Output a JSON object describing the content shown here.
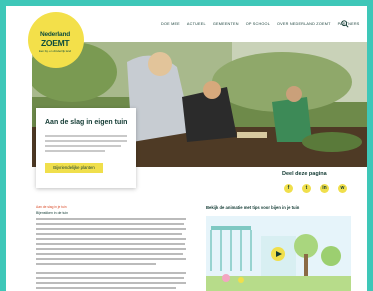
{
  "logo": {
    "line1": "Nederland",
    "line2": "ZOEMT",
    "tagline": "Een bij- en vlinderrijk land"
  },
  "nav": {
    "items": [
      "DOE MEE",
      "ACTUEEL",
      "GEMEENTEN",
      "OP SCHOOL",
      "OVER NEDERLAND ZOEMT",
      "PARTNERS"
    ]
  },
  "hero_card": {
    "title": "Aan de slag in eigen tuin",
    "button_label": "Bijvriendelijke planten"
  },
  "share": {
    "title": "Deel deze pagina",
    "icons": [
      "facebook-icon",
      "twitter-icon",
      "linkedin-icon",
      "whatsapp-icon"
    ]
  },
  "article": {
    "tag": "Aan de slag in je tuin",
    "subtitle": "Bijenstiken in de tuin"
  },
  "video": {
    "title": "Bekijk de animatie met tips voor bijen in je tuin"
  },
  "colors": {
    "teal": "#3ec7b8",
    "yellow": "#f0df4c",
    "dark_green": "#123a33",
    "accent_red": "#d94a27"
  }
}
